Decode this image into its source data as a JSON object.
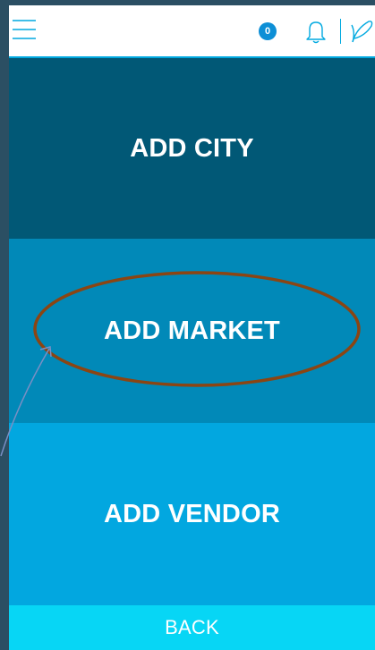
{
  "header": {
    "notification_count": "0",
    "accent_color": "#00a9e0",
    "icons": [
      "menu-icon",
      "bell-icon",
      "feather-icon"
    ]
  },
  "buttons": {
    "add_city": "ADD CITY",
    "add_market": "ADD MARKET",
    "add_vendor": "ADD VENDOR",
    "back": "BACK"
  },
  "annotation": {
    "highlight_color": "#8b4513",
    "arrow_color": "#7a8fc4"
  }
}
